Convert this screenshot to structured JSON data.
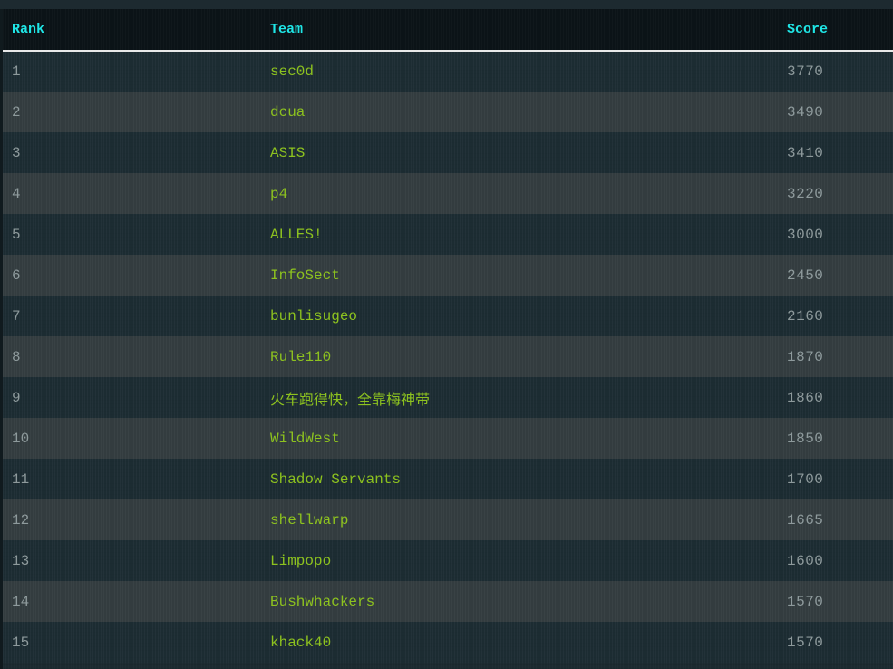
{
  "header": {
    "rank": "Rank",
    "team": "Team",
    "score": "Score"
  },
  "colors": {
    "header_text": "#1fe6e6",
    "team_text": "#8dc21f",
    "muted_text": "#8e9a9c",
    "header_rule": "#e8e8e8"
  },
  "rows": [
    {
      "rank": "1",
      "team": "sec0d",
      "score": "3770"
    },
    {
      "rank": "2",
      "team": "dcua",
      "score": "3490"
    },
    {
      "rank": "3",
      "team": "ASIS",
      "score": "3410"
    },
    {
      "rank": "4",
      "team": "p4",
      "score": "3220"
    },
    {
      "rank": "5",
      "team": "ALLES!",
      "score": "3000"
    },
    {
      "rank": "6",
      "team": "InfoSect",
      "score": "2450"
    },
    {
      "rank": "7",
      "team": "bunlisugeo",
      "score": "2160"
    },
    {
      "rank": "8",
      "team": "Rule110",
      "score": "1870"
    },
    {
      "rank": "9",
      "team": "火车跑得快，全靠梅神带",
      "score": "1860"
    },
    {
      "rank": "10",
      "team": "WildWest",
      "score": "1850"
    },
    {
      "rank": "11",
      "team": "Shadow Servants",
      "score": "1700"
    },
    {
      "rank": "12",
      "team": "shellwarp",
      "score": "1665"
    },
    {
      "rank": "13",
      "team": "Limpopo",
      "score": "1600"
    },
    {
      "rank": "14",
      "team": "Bushwhackers",
      "score": "1570"
    },
    {
      "rank": "15",
      "team": "khack40",
      "score": "1570"
    }
  ]
}
